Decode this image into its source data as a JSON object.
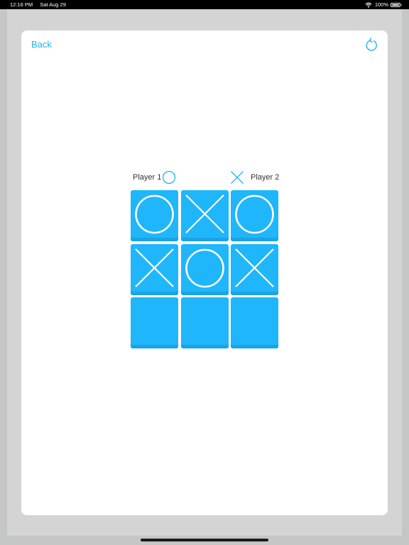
{
  "status_bar": {
    "time": "12:16 PM",
    "date": "Sat Aug 29",
    "battery": "100%"
  },
  "nav": {
    "back_label": "Back",
    "refresh_icon": "refresh-icon"
  },
  "players": [
    {
      "label": "Player 1",
      "mark": "O"
    },
    {
      "label": "Player 2",
      "mark": "X"
    }
  ],
  "board": {
    "cells": [
      "O",
      "X",
      "O",
      "X",
      "O",
      "X",
      "",
      "",
      ""
    ]
  },
  "colors": {
    "accent": "#1fb2f2",
    "cell": "#1fb6fb",
    "cell_shadow": "#1aa3e6"
  }
}
